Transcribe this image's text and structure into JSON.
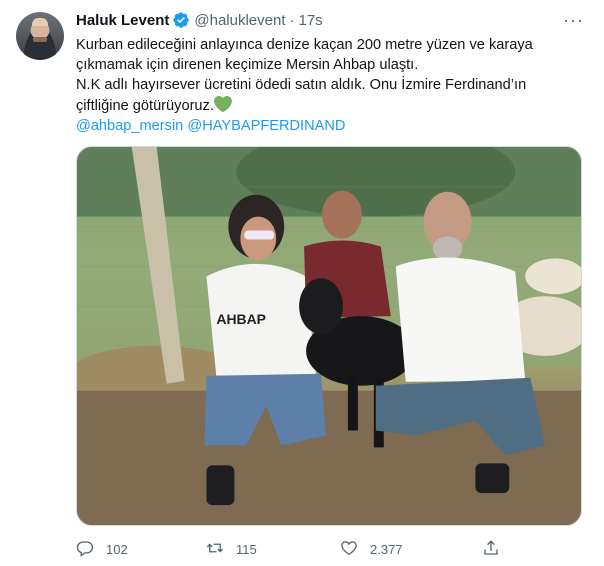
{
  "author": {
    "name": "Haluk Levent",
    "handle": "@haluklevent",
    "separator": "·",
    "time": "17s",
    "more": "···"
  },
  "tweet": {
    "lines": [
      "Kurban edileceğini anlayınca denize kaçan 200 metre yüzen ve karaya",
      "çıkmamak için direnen keçimize Mersin Ahbap ulaştı.",
      "N.K adlı hayırsever ücretini ödedi satın aldık. Onu İzmire Ferdinand’ın",
      "çiftliğine götürüyoruz."
    ],
    "mentions": [
      "@ahbap_mersin",
      "@HAYBAPFERDINAND"
    ]
  },
  "photo": {
    "shirt_text": "AHBAP"
  },
  "actions": {
    "replies": "102",
    "retweets": "115",
    "likes": "2.377"
  },
  "colors": {
    "accent": "#1d9bf0",
    "muted": "#536471",
    "heart": "#78b159"
  },
  "icons": [
    "verified-badge-icon",
    "more-icon",
    "green-heart-icon",
    "reply-icon",
    "retweet-icon",
    "like-icon",
    "share-icon"
  ]
}
